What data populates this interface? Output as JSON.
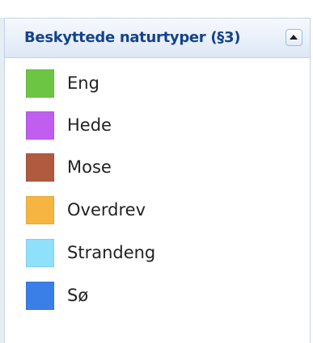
{
  "legend": {
    "title": "Beskyttede naturtyper (§3)",
    "collapse_icon": "caret-up-icon",
    "items": [
      {
        "label": "Eng",
        "color": "#6cc644"
      },
      {
        "label": "Hede",
        "color": "#c05ef0"
      },
      {
        "label": "Mose",
        "color": "#b05a3f"
      },
      {
        "label": "Overdrev",
        "color": "#f6b540"
      },
      {
        "label": "Strandeng",
        "color": "#8fe0fb"
      },
      {
        "label": "Sø",
        "color": "#3a7ee8"
      }
    ]
  }
}
